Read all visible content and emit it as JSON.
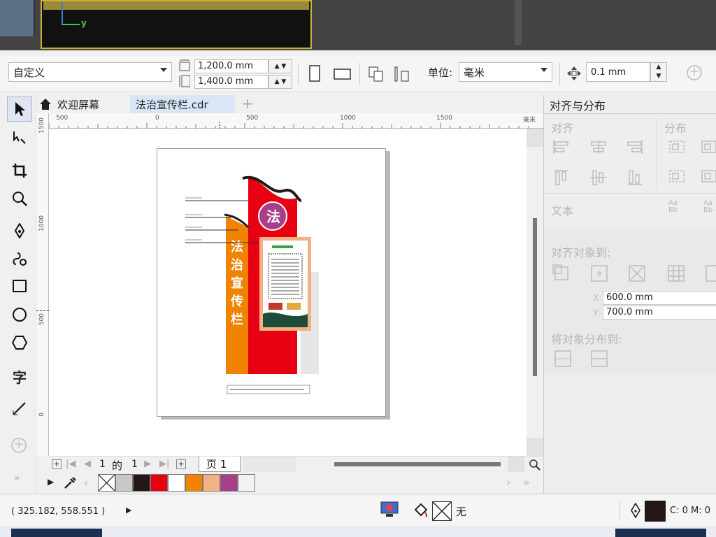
{
  "top_strip": {
    "axis_label": "y"
  },
  "propbar": {
    "page_size_preset": "自定义",
    "width_value": "1,200.0 mm",
    "height_value": "1,400.0 mm",
    "units_label": "单位:",
    "units_value": "毫米",
    "nudge_value": "0.1 mm"
  },
  "tabs": [
    {
      "label": "欢迎屏幕",
      "icon": "home-icon"
    },
    {
      "label": "法治宣传栏.cdr"
    }
  ],
  "rulers": {
    "top_ticks": [
      "500",
      "0",
      "500",
      "1000",
      "1500"
    ],
    "top_unit": "毫米",
    "left_ticks": [
      "1500",
      "1000",
      "500",
      "0"
    ]
  },
  "artwork": {
    "badge_char": "法",
    "vertical_title": [
      "法",
      "治",
      "宣",
      "传",
      "栏"
    ]
  },
  "pagebar": {
    "current": "1",
    "of_label": "的",
    "total": "1",
    "page_tab": "页 1"
  },
  "palette": {
    "colors": [
      "#c8c8c8",
      "#231815",
      "#e60012",
      "#ffffff",
      "#f08300",
      "#f4b183",
      "#a93f88",
      "#f2f2f2"
    ]
  },
  "docker": {
    "title": "对齐与分布",
    "align_label": "对齐",
    "distribute_label": "分布",
    "text_label": "文本",
    "align_to_label": "对齐对象到:",
    "x_label": "X:",
    "x_value": "600.0 mm",
    "y_label": "Y:",
    "y_value": "700.0 mm",
    "distribute_to_label": "将对象分布到:"
  },
  "status": {
    "coordinates": "( 325.182, 558.551 )",
    "fill_none_label": "无",
    "outline_color_text": "C: 0 M: 0"
  },
  "colors": {
    "accent_red": "#e60012",
    "accent_orange": "#f08300",
    "dark_curve": "#231815"
  }
}
